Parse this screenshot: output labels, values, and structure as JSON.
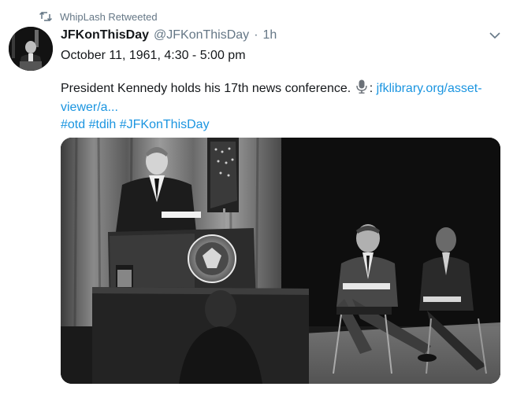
{
  "retweet": {
    "icon": "retweet-icon",
    "text": "WhipLash Retweeted"
  },
  "tweet": {
    "display_name": "JFKonThisDay",
    "handle": "@JFKonThisDay",
    "separator": "·",
    "time": "1h",
    "date_line": "October 11, 1961, 4:30 - 5:00 pm",
    "body_text": "President Kennedy holds his 17th news conference.",
    "mic_icon": "microphone-icon",
    "link_prefix": ":",
    "link_part_1": "jfklibrary.org/asset-",
    "link_part_2": "viewer/a...",
    "hashtags": [
      "#otd",
      "#tdih",
      "#JFKonThisDay"
    ]
  },
  "colors": {
    "link": "#1b95e0",
    "secondary_text": "#657786",
    "primary_text": "#14171a"
  }
}
